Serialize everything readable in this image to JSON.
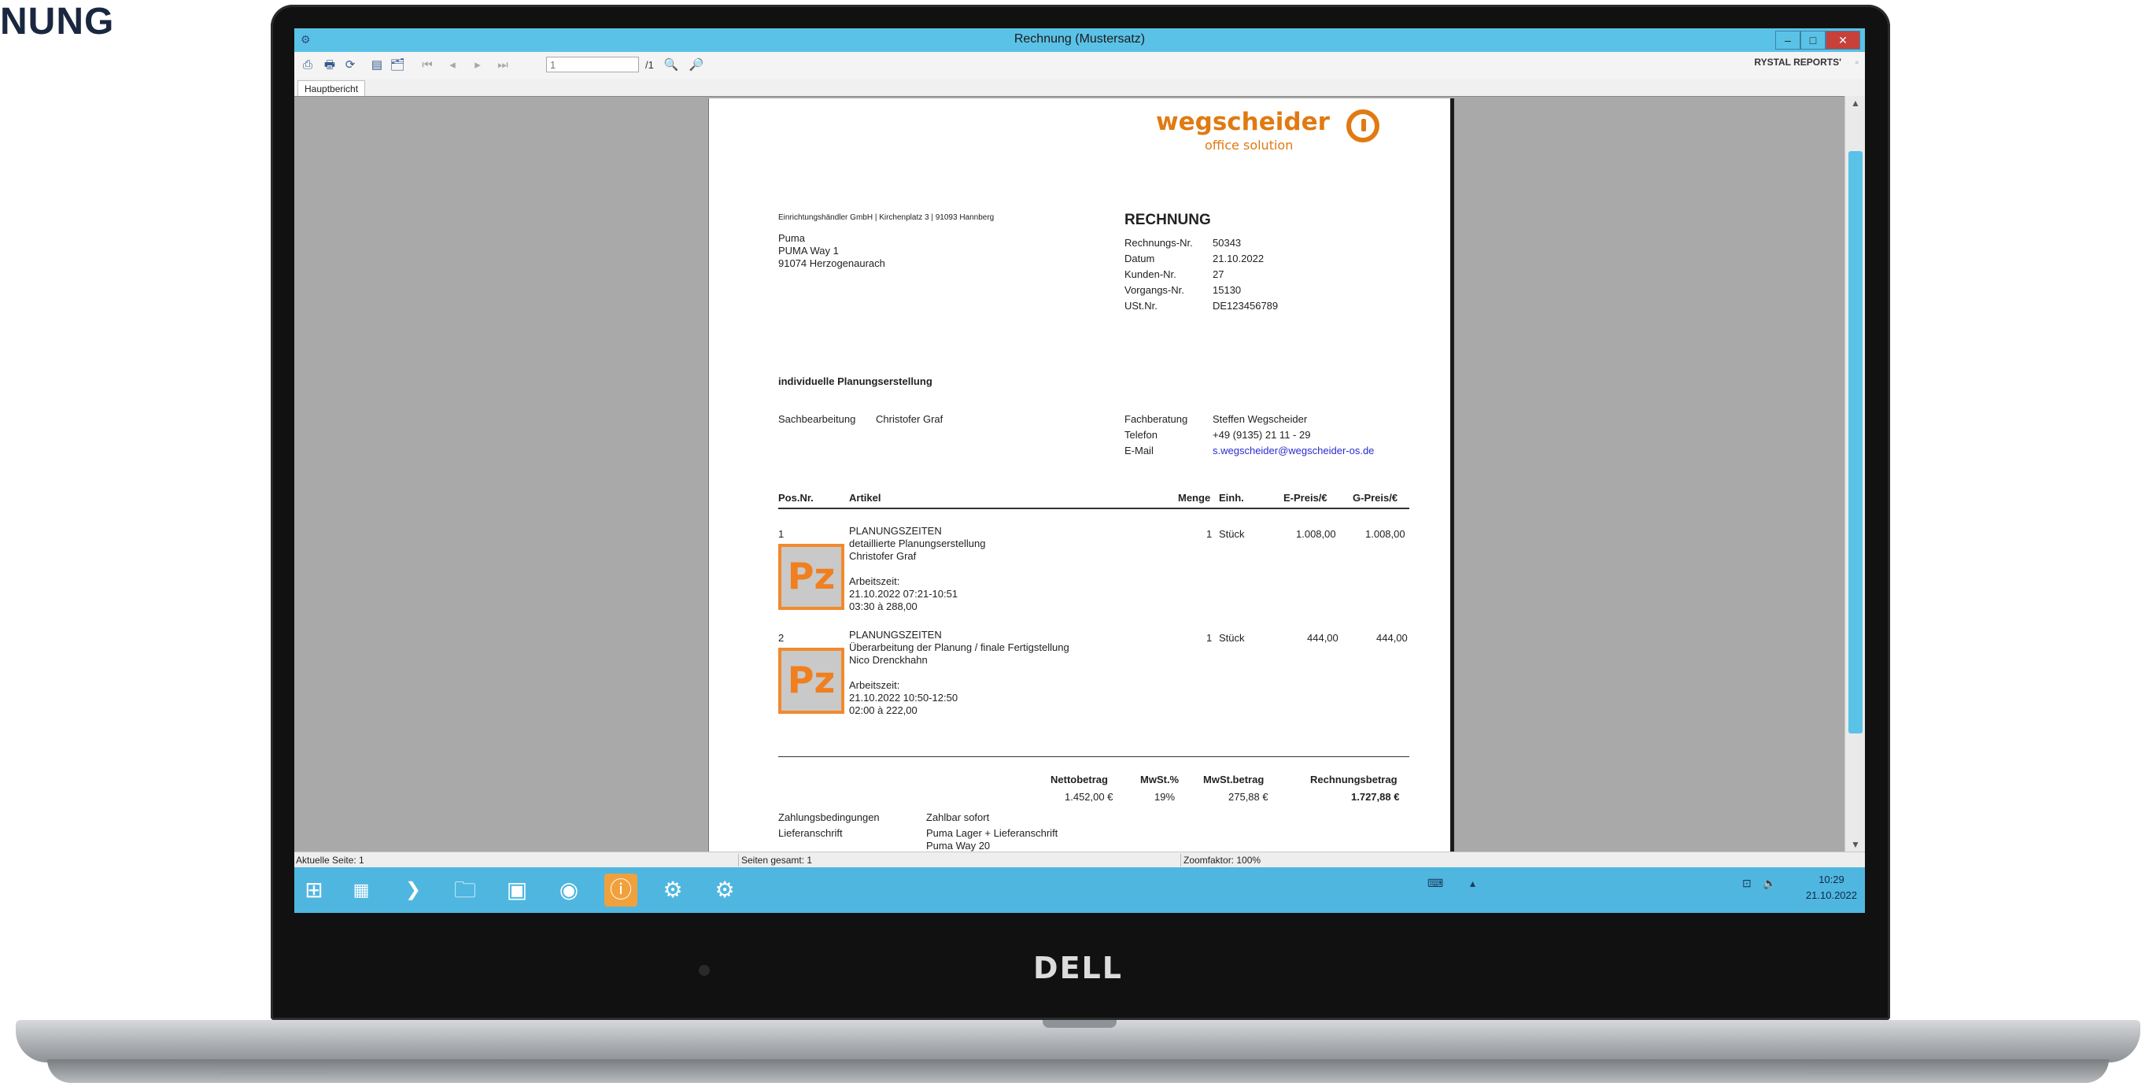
{
  "page_heading": "NUNG",
  "device_brand": "DELL",
  "window": {
    "title": "Rechnung (Mustersatz)",
    "minimize": "–",
    "maximize": "□",
    "close": "✕"
  },
  "toolbar": {
    "page_input": "1",
    "page_of": "/1",
    "brand_label": "RYSTAL REPORTS'",
    "brand_close": "▫"
  },
  "tabs": [
    "Hauptbericht"
  ],
  "report": {
    "logo_word": "wegscheider",
    "logo_sub": "office solution",
    "sender_line": "Einrichtungshändler GmbH | Kirchenplatz 3 | 91093 Hannberg",
    "heading": "RECHNUNG",
    "recipient": [
      "Puma",
      "PUMA Way 1",
      "91074  Herzogenaurach"
    ],
    "meta_labels": [
      "Rechnungs-Nr.",
      "Datum",
      "Kunden-Nr.",
      "Vorgangs-Nr.",
      "USt.Nr."
    ],
    "meta_values": [
      "50343",
      "21.10.2022",
      "27",
      "15130",
      "DE123456789"
    ],
    "subject": "individuelle Planungserstellung",
    "clerk_label": "Sachbearbeitung",
    "clerk_name": "Christofer Graf",
    "contact_labels": [
      "Fachberatung",
      "Telefon",
      "E-Mail"
    ],
    "contact_values": [
      "Steffen Wegscheider",
      "+49 (9135) 21 11 - 29",
      "s.wegscheider@wegscheider-os.de"
    ],
    "columns": {
      "pos": "Pos.Nr.",
      "article": "Artikel",
      "qty": "Menge",
      "unit": "Einh.",
      "unit_price": "E-Preis/€",
      "total_price": "G-Preis/€"
    },
    "items": [
      {
        "pos": "1",
        "lines": [
          "PLANUNGSZEITEN",
          "detaillierte Planungserstellung",
          "Christofer Graf",
          "",
          "Arbeitszeit:",
          "21.10.2022 07:21-10:51",
          "03:30 à 288,00"
        ],
        "qty": "1",
        "unit": "Stück",
        "unit_price": "1.008,00",
        "total_price": "1.008,00",
        "image_text": "Pz"
      },
      {
        "pos": "2",
        "lines": [
          "PLANUNGSZEITEN",
          "Überarbeitung der Planung / finale Fertigstellung",
          "Nico Drenckhahn",
          "",
          "Arbeitszeit:",
          "21.10.2022 10:50-12:50",
          "02:00 à 222,00"
        ],
        "qty": "1",
        "unit": "Stück",
        "unit_price": "444,00",
        "total_price": "444,00",
        "image_text": "Pz"
      }
    ],
    "totals": {
      "net_label": "Nettobetrag",
      "vat_pct_label": "MwSt.%",
      "vat_amount_label": "MwSt.betrag",
      "invoice_total_label": "Rechnungsbetrag",
      "net": "1.452,00 €",
      "vat_pct": "19%",
      "vat_amount": "275,88 €",
      "invoice_total": "1.727,88 €"
    },
    "footer_labels": [
      "Zahlungsbedingungen",
      "Lieferanschrift"
    ],
    "footer_values": [
      "Zahlbar sofort",
      "Puma Lager + Lieferanschrift",
      "Puma Way 20"
    ]
  },
  "statusbar": {
    "current_page": "Aktuelle Seite: 1",
    "total_pages": "Seiten gesamt: 1",
    "zoom": "Zoomfaktor: 100%"
  },
  "taskbar": {
    "clock_time": "10:29",
    "clock_date": "21.10.2022"
  }
}
